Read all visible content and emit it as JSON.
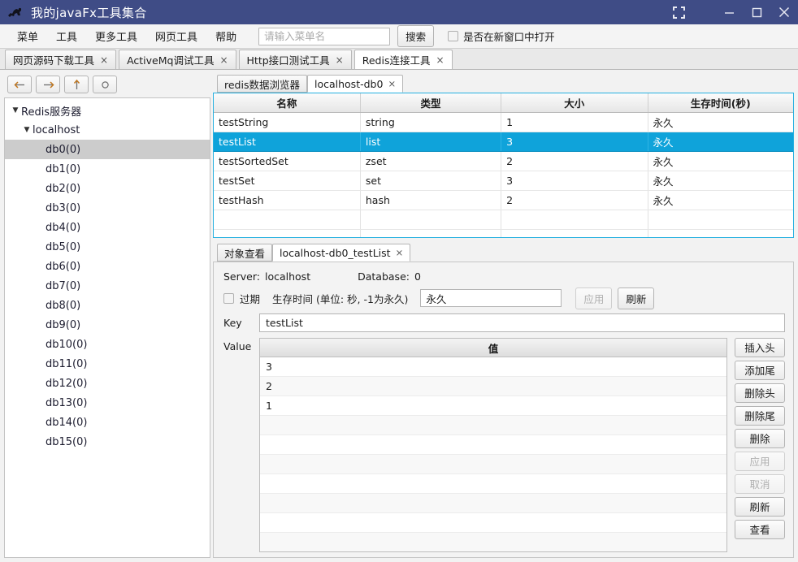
{
  "window": {
    "title": "我的javaFx工具集合",
    "icon": "duke-silhouette-icon",
    "controls": {
      "fullscreen": "fullscreen-icon",
      "minimize": "minimize-icon",
      "maximize": "maximize-icon",
      "close": "close-icon"
    }
  },
  "menubar": {
    "items": [
      "菜单",
      "工具",
      "更多工具",
      "网页工具",
      "帮助"
    ],
    "search": {
      "value": "",
      "placeholder": "请输入菜单名"
    },
    "search_button": "搜索",
    "new_window_checkbox": {
      "label": "是否在新窗口中打开",
      "checked": false
    }
  },
  "tool_tabs": [
    {
      "label": "网页源码下载工具",
      "close": "×",
      "active": false
    },
    {
      "label": "ActiveMq调试工具",
      "close": "×",
      "active": false
    },
    {
      "label": "Http接口测试工具",
      "close": "×",
      "active": false
    },
    {
      "label": "Redis连接工具",
      "close": "×",
      "active": true
    }
  ],
  "sidebar": {
    "nav": [
      {
        "name": "back-button",
        "glyph": "←"
      },
      {
        "name": "forward-button",
        "glyph": "→"
      },
      {
        "name": "up-button",
        "glyph": "↑"
      },
      {
        "name": "refresh-button",
        "glyph": "○"
      }
    ],
    "tree": [
      {
        "label": "Redis服务器",
        "level": 0,
        "arrow": "▼",
        "selected": false
      },
      {
        "label": "localhost",
        "level": 1,
        "arrow": "▼",
        "selected": false
      },
      {
        "label": "db0(0)",
        "level": 2,
        "arrow": "",
        "selected": true
      },
      {
        "label": "db1(0)",
        "level": 2,
        "arrow": "",
        "selected": false
      },
      {
        "label": "db2(0)",
        "level": 2,
        "arrow": "",
        "selected": false
      },
      {
        "label": "db3(0)",
        "level": 2,
        "arrow": "",
        "selected": false
      },
      {
        "label": "db4(0)",
        "level": 2,
        "arrow": "",
        "selected": false
      },
      {
        "label": "db5(0)",
        "level": 2,
        "arrow": "",
        "selected": false
      },
      {
        "label": "db6(0)",
        "level": 2,
        "arrow": "",
        "selected": false
      },
      {
        "label": "db7(0)",
        "level": 2,
        "arrow": "",
        "selected": false
      },
      {
        "label": "db8(0)",
        "level": 2,
        "arrow": "",
        "selected": false
      },
      {
        "label": "db9(0)",
        "level": 2,
        "arrow": "",
        "selected": false
      },
      {
        "label": "db10(0)",
        "level": 2,
        "arrow": "",
        "selected": false
      },
      {
        "label": "db11(0)",
        "level": 2,
        "arrow": "",
        "selected": false
      },
      {
        "label": "db12(0)",
        "level": 2,
        "arrow": "",
        "selected": false
      },
      {
        "label": "db13(0)",
        "level": 2,
        "arrow": "",
        "selected": false
      },
      {
        "label": "db14(0)",
        "level": 2,
        "arrow": "",
        "selected": false
      },
      {
        "label": "db15(0)",
        "level": 2,
        "arrow": "",
        "selected": false
      }
    ]
  },
  "browser_panel": {
    "tabs": [
      {
        "label": "redis数据浏览器",
        "close": "",
        "active": false
      },
      {
        "label": "localhost-db0",
        "close": "×",
        "active": true
      }
    ],
    "table": {
      "columns": [
        "名称",
        "类型",
        "大小",
        "生存时间(秒)"
      ],
      "rows": [
        {
          "cells": [
            "testString",
            "string",
            "1",
            "永久"
          ],
          "selected": false
        },
        {
          "cells": [
            "testList",
            "list",
            "3",
            "永久"
          ],
          "selected": true
        },
        {
          "cells": [
            "testSortedSet",
            "zset",
            "2",
            "永久"
          ],
          "selected": false
        },
        {
          "cells": [
            "testSet",
            "set",
            "3",
            "永久"
          ],
          "selected": false
        },
        {
          "cells": [
            "testHash",
            "hash",
            "2",
            "永久"
          ],
          "selected": false
        },
        {
          "cells": [
            "",
            "",
            "",
            ""
          ],
          "selected": false
        },
        {
          "cells": [
            "",
            "",
            "",
            ""
          ],
          "selected": false
        }
      ]
    }
  },
  "detail_panel": {
    "tabs": [
      {
        "label": "对象查看",
        "close": "",
        "active": false
      },
      {
        "label": "localhost-db0_testList",
        "close": "×",
        "active": true
      }
    ],
    "server_label": "Server:",
    "server_value": "localhost",
    "database_label": "Database:",
    "database_value": "0",
    "expire_checkbox": {
      "label": "过期",
      "checked": false
    },
    "ttl_label": "生存时间 (单位: 秒, -1为永久)",
    "ttl_value": "永久",
    "ttl_apply_button": {
      "label": "应用",
      "disabled": true
    },
    "ttl_refresh_button": {
      "label": "刷新",
      "disabled": false
    },
    "key_label": "Key",
    "key_value": "testList",
    "value_label": "Value",
    "value_column": "值",
    "values": [
      "3",
      "2",
      "1",
      "",
      "",
      "",
      "",
      "",
      "",
      ""
    ],
    "side_buttons": [
      {
        "label": "插入头",
        "disabled": false
      },
      {
        "label": "添加尾",
        "disabled": false
      },
      {
        "label": "删除头",
        "disabled": false
      },
      {
        "label": "删除尾",
        "disabled": false
      },
      {
        "label": "删除",
        "disabled": false
      },
      {
        "label": "应用",
        "disabled": true
      },
      {
        "label": "取消",
        "disabled": true
      },
      {
        "label": "刷新",
        "disabled": false
      },
      {
        "label": "查看",
        "disabled": false
      }
    ]
  },
  "colors": {
    "titlebar": "#3f4c86",
    "selection": "#0fa3da",
    "panel_border": "#25b0e0",
    "tree_selection": "#cccccc"
  }
}
